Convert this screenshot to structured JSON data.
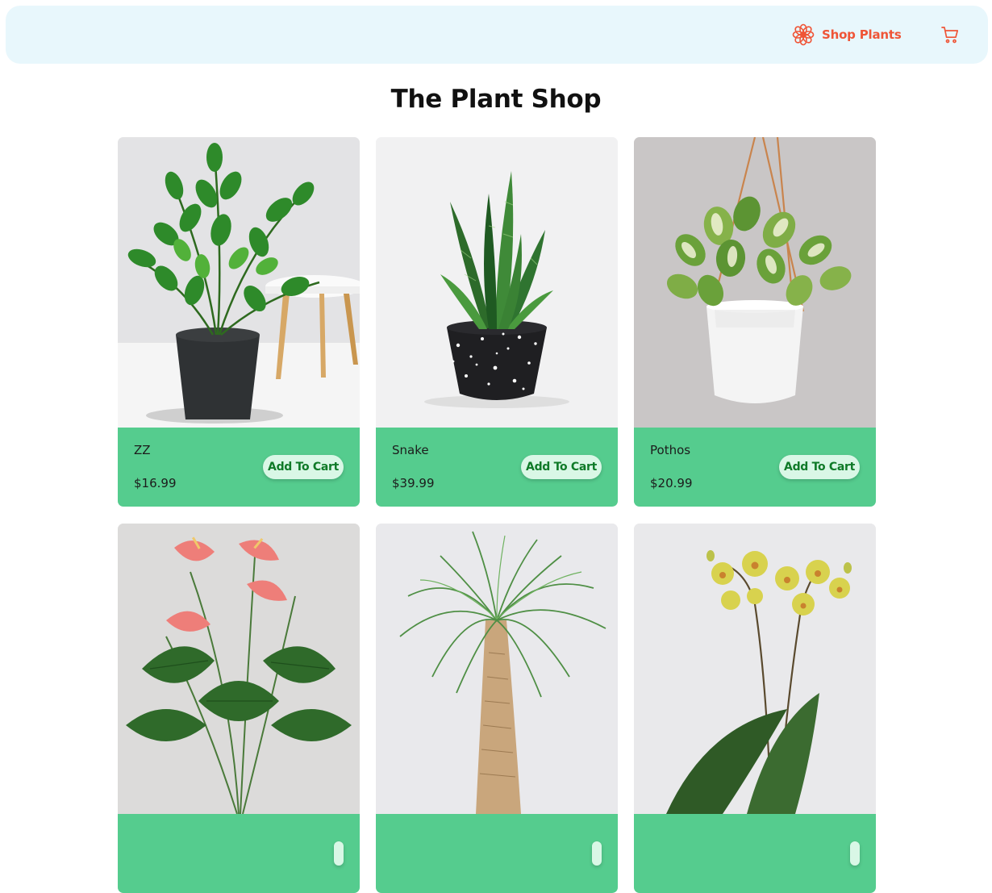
{
  "nav": {
    "brand_label": "Shop Plants",
    "brand_icon": "flower-icon",
    "cart_icon": "cart-icon",
    "accent_color": "#ef5537",
    "background_color": "#e8f7fc"
  },
  "page": {
    "title": "The Plant Shop"
  },
  "colors": {
    "card_info_background": "#55cc8e",
    "button_background": "#d9f7e6",
    "button_text": "#0f7a28"
  },
  "products": [
    {
      "name": "ZZ",
      "price": "$16.99",
      "button_label": "Add To Cart"
    },
    {
      "name": "Snake",
      "price": "$39.99",
      "button_label": "Add To Cart"
    },
    {
      "name": "Pothos",
      "price": "$20.99",
      "button_label": "Add To Cart"
    },
    {
      "name": "",
      "price": "",
      "button_label": ""
    },
    {
      "name": "",
      "price": "",
      "button_label": ""
    },
    {
      "name": "",
      "price": "",
      "button_label": ""
    }
  ]
}
